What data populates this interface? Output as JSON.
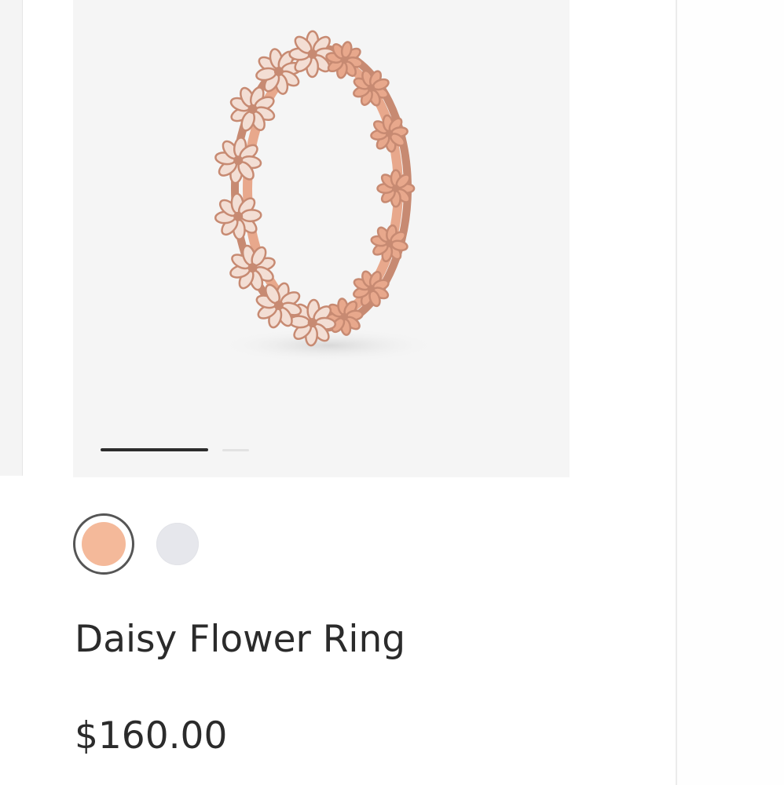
{
  "product": {
    "name": "Daisy Flower Ring",
    "price": "$160.00",
    "image_icon": "daisy-flower-ring-image",
    "carousel": {
      "total": 2,
      "active": 1
    },
    "swatches": [
      {
        "name": "rose-gold",
        "color": "#f4b99a",
        "selected": true
      },
      {
        "name": "silver",
        "color": "#e6e7ec",
        "selected": false
      }
    ]
  },
  "colors": {
    "metal": "#e8a88c",
    "metal_dark": "#c78a72",
    "text": "#2b2b2b",
    "indicator_active": "#2c2c2c"
  }
}
